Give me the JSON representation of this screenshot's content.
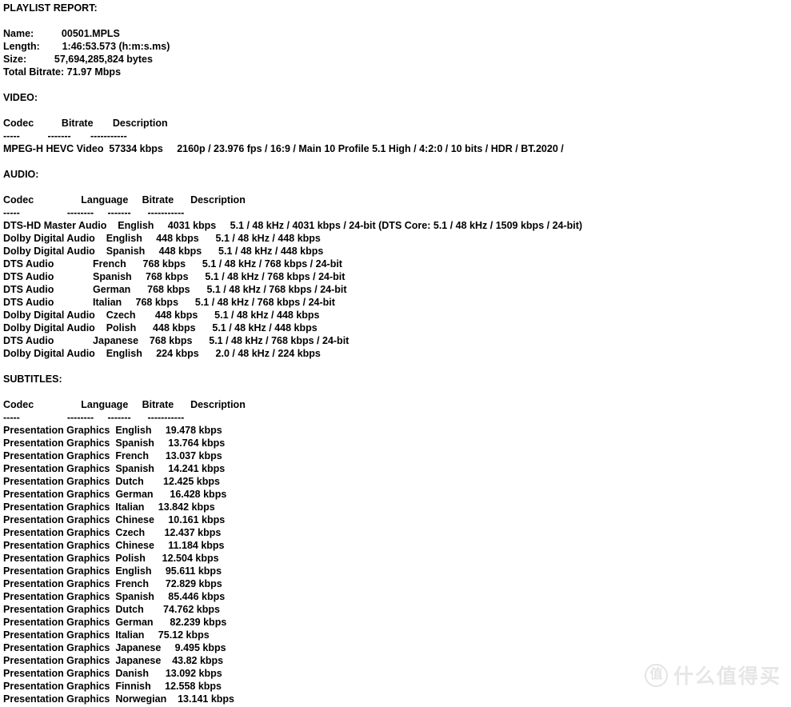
{
  "report": {
    "title": "PLAYLIST REPORT:",
    "summary": {
      "rows": [
        {
          "label": "Name:",
          "value": "00501.MPLS"
        },
        {
          "label": "Length:",
          "value": "1:46:53.573 (h:m:s.ms)"
        },
        {
          "label": "Size:",
          "value": "57,694,285,824 bytes"
        },
        {
          "label": "Total Bitrate:",
          "value": "71.97 Mbps"
        }
      ],
      "lines": [
        "Name:          00501.MPLS",
        "Length:        1:46:53.573 (h:m:s.ms)",
        "Size:          57,694,285,824 bytes",
        "Total Bitrate: 71.97 Mbps"
      ]
    },
    "video": {
      "section_title": "VIDEO:",
      "headers": [
        "Codec",
        "Bitrate",
        "Description"
      ],
      "header_line": "Codec          Bitrate       Description",
      "rule_line": "-----          -------       -----------",
      "rules": [
        "-----",
        "-------",
        "-----------"
      ],
      "rows": [
        {
          "codec": "MPEG-H HEVC Video",
          "bitrate": "57334 kbps",
          "description": "2160p / 23.976 fps / 16:9 / Main 10 Profile 5.1 High / 4:2:0 / 10 bits / HDR / BT.2020 /",
          "line": "MPEG-H HEVC Video  57334 kbps     2160p / 23.976 fps / 16:9 / Main 10 Profile 5.1 High / 4:2:0 / 10 bits / HDR / BT.2020 /"
        }
      ]
    },
    "audio": {
      "section_title": "AUDIO:",
      "headers": [
        "Codec",
        "Language",
        "Bitrate",
        "Description"
      ],
      "header_line": "Codec                 Language     Bitrate      Description",
      "rule_line": "-----                 --------     -------      -----------",
      "rules": [
        "-----",
        "--------",
        "-------",
        "-----------"
      ],
      "rows": [
        {
          "codec": "DTS-HD Master Audio",
          "language": "English",
          "bitrate": "4031 kbps",
          "description": "5.1 / 48 kHz / 4031 kbps / 24-bit (DTS Core: 5.1 / 48 kHz / 1509 kbps / 24-bit)",
          "line": "DTS-HD Master Audio    English     4031 kbps     5.1 / 48 kHz / 4031 kbps / 24-bit (DTS Core: 5.1 / 48 kHz / 1509 kbps / 24-bit)"
        },
        {
          "codec": "Dolby Digital Audio",
          "language": "English",
          "bitrate": "448 kbps",
          "description": "5.1 / 48 kHz / 448 kbps",
          "line": "Dolby Digital Audio    English     448 kbps      5.1 / 48 kHz / 448 kbps"
        },
        {
          "codec": "Dolby Digital Audio",
          "language": "Spanish",
          "bitrate": "448 kbps",
          "description": "5.1 / 48 kHz / 448 kbps",
          "line": "Dolby Digital Audio    Spanish     448 kbps      5.1 / 48 kHz / 448 kbps"
        },
        {
          "codec": "DTS Audio",
          "language": "French",
          "bitrate": "768 kbps",
          "description": "5.1 / 48 kHz / 768 kbps / 24-bit",
          "line": "DTS Audio              French      768 kbps      5.1 / 48 kHz / 768 kbps / 24-bit"
        },
        {
          "codec": "DTS Audio",
          "language": "Spanish",
          "bitrate": "768 kbps",
          "description": "5.1 / 48 kHz / 768 kbps / 24-bit",
          "line": "DTS Audio              Spanish     768 kbps      5.1 / 48 kHz / 768 kbps / 24-bit"
        },
        {
          "codec": "DTS Audio",
          "language": "German",
          "bitrate": "768 kbps",
          "description": "5.1 / 48 kHz / 768 kbps / 24-bit",
          "line": "DTS Audio              German      768 kbps      5.1 / 48 kHz / 768 kbps / 24-bit"
        },
        {
          "codec": "DTS Audio",
          "language": "Italian",
          "bitrate": "768 kbps",
          "description": "5.1 / 48 kHz / 768 kbps / 24-bit",
          "line": "DTS Audio              Italian     768 kbps      5.1 / 48 kHz / 768 kbps / 24-bit"
        },
        {
          "codec": "Dolby Digital Audio",
          "language": "Czech",
          "bitrate": "448 kbps",
          "description": "5.1 / 48 kHz / 448 kbps",
          "line": "Dolby Digital Audio    Czech       448 kbps      5.1 / 48 kHz / 448 kbps"
        },
        {
          "codec": "Dolby Digital Audio",
          "language": "Polish",
          "bitrate": "448 kbps",
          "description": "5.1 / 48 kHz / 448 kbps",
          "line": "Dolby Digital Audio    Polish      448 kbps      5.1 / 48 kHz / 448 kbps"
        },
        {
          "codec": "DTS Audio",
          "language": "Japanese",
          "bitrate": "768 kbps",
          "description": "5.1 / 48 kHz / 768 kbps / 24-bit",
          "line": "DTS Audio              Japanese    768 kbps      5.1 / 48 kHz / 768 kbps / 24-bit"
        },
        {
          "codec": "Dolby Digital Audio",
          "language": "English",
          "bitrate": "224 kbps",
          "description": "2.0 / 48 kHz / 224 kbps",
          "line": "Dolby Digital Audio    English     224 kbps      2.0 / 48 kHz / 224 kbps"
        }
      ]
    },
    "subtitles": {
      "section_title": "SUBTITLES:",
      "headers": [
        "Codec",
        "Language",
        "Bitrate",
        "Description"
      ],
      "header_line": "Codec                 Language     Bitrate      Description",
      "rule_line": "-----                 --------     -------      -----------",
      "rules": [
        "-----",
        "--------",
        "-------",
        "-----------"
      ],
      "rows": [
        {
          "codec": "Presentation Graphics",
          "language": "English",
          "bitrate": "19.478 kbps",
          "line": "Presentation Graphics  English     19.478 kbps"
        },
        {
          "codec": "Presentation Graphics",
          "language": "Spanish",
          "bitrate": "13.764 kbps",
          "line": "Presentation Graphics  Spanish     13.764 kbps"
        },
        {
          "codec": "Presentation Graphics",
          "language": "French",
          "bitrate": "13.037 kbps",
          "line": "Presentation Graphics  French      13.037 kbps"
        },
        {
          "codec": "Presentation Graphics",
          "language": "Spanish",
          "bitrate": "14.241 kbps",
          "line": "Presentation Graphics  Spanish     14.241 kbps"
        },
        {
          "codec": "Presentation Graphics",
          "language": "Dutch",
          "bitrate": "12.425 kbps",
          "line": "Presentation Graphics  Dutch       12.425 kbps"
        },
        {
          "codec": "Presentation Graphics",
          "language": "German",
          "bitrate": "16.428 kbps",
          "line": "Presentation Graphics  German      16.428 kbps"
        },
        {
          "codec": "Presentation Graphics",
          "language": "Italian",
          "bitrate": "13.842 kbps",
          "line": "Presentation Graphics  Italian     13.842 kbps"
        },
        {
          "codec": "Presentation Graphics",
          "language": "Chinese",
          "bitrate": "10.161 kbps",
          "line": "Presentation Graphics  Chinese     10.161 kbps"
        },
        {
          "codec": "Presentation Graphics",
          "language": "Czech",
          "bitrate": "12.437 kbps",
          "line": "Presentation Graphics  Czech       12.437 kbps"
        },
        {
          "codec": "Presentation Graphics",
          "language": "Chinese",
          "bitrate": "11.184 kbps",
          "line": "Presentation Graphics  Chinese     11.184 kbps"
        },
        {
          "codec": "Presentation Graphics",
          "language": "Polish",
          "bitrate": "12.504 kbps",
          "line": "Presentation Graphics  Polish      12.504 kbps"
        },
        {
          "codec": "Presentation Graphics",
          "language": "English",
          "bitrate": "95.611 kbps",
          "line": "Presentation Graphics  English     95.611 kbps"
        },
        {
          "codec": "Presentation Graphics",
          "language": "French",
          "bitrate": "72.829 kbps",
          "line": "Presentation Graphics  French      72.829 kbps"
        },
        {
          "codec": "Presentation Graphics",
          "language": "Spanish",
          "bitrate": "85.446 kbps",
          "line": "Presentation Graphics  Spanish     85.446 kbps"
        },
        {
          "codec": "Presentation Graphics",
          "language": "Dutch",
          "bitrate": "74.762 kbps",
          "line": "Presentation Graphics  Dutch       74.762 kbps"
        },
        {
          "codec": "Presentation Graphics",
          "language": "German",
          "bitrate": "82.239 kbps",
          "line": "Presentation Graphics  German      82.239 kbps"
        },
        {
          "codec": "Presentation Graphics",
          "language": "Italian",
          "bitrate": "75.12 kbps",
          "line": "Presentation Graphics  Italian     75.12 kbps"
        },
        {
          "codec": "Presentation Graphics",
          "language": "Japanese",
          "bitrate": "9.495 kbps",
          "line": "Presentation Graphics  Japanese     9.495 kbps"
        },
        {
          "codec": "Presentation Graphics",
          "language": "Japanese",
          "bitrate": "43.82 kbps",
          "line": "Presentation Graphics  Japanese    43.82 kbps"
        },
        {
          "codec": "Presentation Graphics",
          "language": "Danish",
          "bitrate": "13.092 kbps",
          "line": "Presentation Graphics  Danish      13.092 kbps"
        },
        {
          "codec": "Presentation Graphics",
          "language": "Finnish",
          "bitrate": "12.558 kbps",
          "line": "Presentation Graphics  Finnish     12.558 kbps"
        },
        {
          "codec": "Presentation Graphics",
          "language": "Norwegian",
          "bitrate": "13.141 kbps",
          "line": "Presentation Graphics  Norwegian    13.141 kbps"
        }
      ]
    }
  },
  "watermark": {
    "badge": "值",
    "text": "什么值得买",
    "color": "#e6e6e6"
  }
}
